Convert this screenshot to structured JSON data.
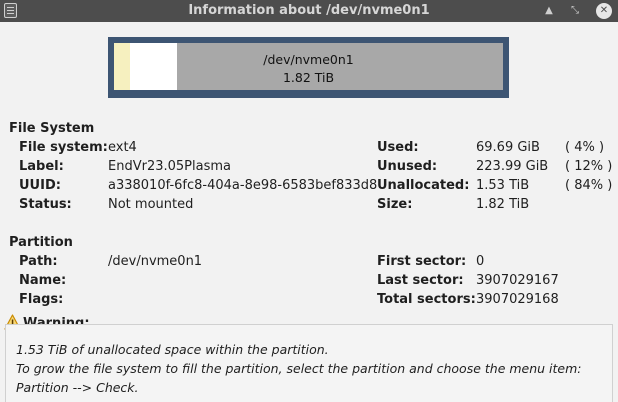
{
  "window": {
    "title": "Information about /dev/nvme0n1",
    "icons": {
      "app": "document-icon",
      "minimize": "minimize-icon",
      "maximize": "maximize-icon",
      "close": "close-icon"
    }
  },
  "usage_bar": {
    "device": "/dev/nvme0n1",
    "size": "1.82 TiB",
    "used_fraction": 0.04,
    "unused_fraction": 0.12,
    "unallocated_fraction": 0.84,
    "colors": {
      "frame": "#3d5573",
      "used": "#f6f0bf",
      "unused": "#ffffff",
      "unallocated": "#a8a8a8"
    }
  },
  "file_system": {
    "heading": "File System",
    "filesystem_label": "File system:",
    "filesystem_value": "ext4",
    "label_label": "Label:",
    "label_value": "EndVr23.05Plasma",
    "uuid_label": "UUID:",
    "uuid_value": "a338010f-6fc8-404a-8e98-6583bef833d8",
    "status_label": "Status:",
    "status_value": "Not mounted",
    "used_label": "Used:",
    "used_value": "69.69 GiB",
    "used_pct": "( 4% )",
    "unused_label": "Unused:",
    "unused_value": "223.99 GiB",
    "unused_pct": "( 12% )",
    "unallocated_label": "Unallocated:",
    "unallocated_value": "1.53 TiB",
    "unallocated_pct": "( 84% )",
    "size_label": "Size:",
    "size_value": "1.82 TiB"
  },
  "partition": {
    "heading": "Partition",
    "path_label": "Path:",
    "path_value": "/dev/nvme0n1",
    "name_label": "Name:",
    "name_value": "",
    "flags_label": "Flags:",
    "flags_value": "",
    "first_sector_label": "First sector:",
    "first_sector_value": "0",
    "last_sector_label": "Last sector:",
    "last_sector_value": "3907029167",
    "total_sectors_label": "Total sectors:",
    "total_sectors_value": "3907029168"
  },
  "warning": {
    "heading": "Warning:",
    "icon": "warning-icon",
    "lines": [
      "1.53 TiB of unallocated space within the partition.",
      "To grow the file system to fill the partition, select the partition and choose the menu item:",
      "Partition --> Check."
    ]
  }
}
